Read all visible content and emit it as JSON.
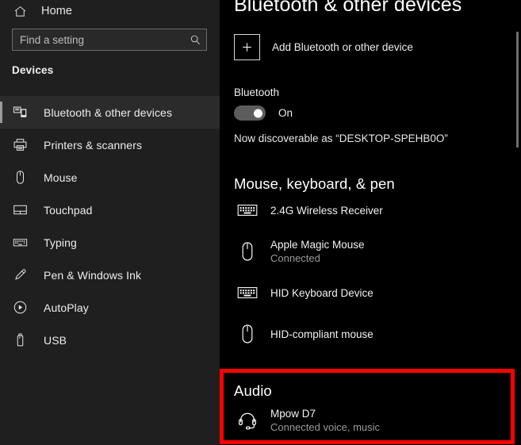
{
  "sidebar": {
    "home": {
      "label": "Home",
      "icon": "home-icon"
    },
    "search": {
      "placeholder": "Find a setting",
      "value": "",
      "icon": "search-icon"
    },
    "section_title": "Devices",
    "items": [
      {
        "label": "Bluetooth & other devices",
        "icon": "bluetooth-devices-icon",
        "selected": true
      },
      {
        "label": "Printers & scanners",
        "icon": "printer-icon",
        "selected": false
      },
      {
        "label": "Mouse",
        "icon": "mouse-icon",
        "selected": false
      },
      {
        "label": "Touchpad",
        "icon": "touchpad-icon",
        "selected": false
      },
      {
        "label": "Typing",
        "icon": "keyboard-icon",
        "selected": false
      },
      {
        "label": "Pen & Windows Ink",
        "icon": "pen-icon",
        "selected": false
      },
      {
        "label": "AutoPlay",
        "icon": "autoplay-icon",
        "selected": false
      },
      {
        "label": "USB",
        "icon": "usb-icon",
        "selected": false
      }
    ]
  },
  "main": {
    "title": "Bluetooth & other devices",
    "add_device": {
      "label": "Add Bluetooth or other device",
      "icon": "plus-icon"
    },
    "bluetooth": {
      "label": "Bluetooth",
      "state": "On",
      "toggle_on": true,
      "discoverable_text": "Now discoverable as “DESKTOP-SPEHB0O”"
    },
    "groups": [
      {
        "heading": "Mouse, keyboard, & pen",
        "devices": [
          {
            "name": "2.4G Wireless Receiver",
            "status": "",
            "icon": "keyboard-icon"
          },
          {
            "name": "Apple Magic Mouse",
            "status": "Connected",
            "icon": "mouse-icon"
          },
          {
            "name": "HID Keyboard Device",
            "status": "",
            "icon": "keyboard-icon"
          },
          {
            "name": "HID-compliant mouse",
            "status": "",
            "icon": "mouse-icon"
          }
        ]
      },
      {
        "heading": "Audio",
        "devices": [
          {
            "name": "Mpow D7",
            "status": "Connected voice, music",
            "icon": "headset-icon"
          }
        ]
      }
    ],
    "scrollbar": {
      "name": "vertical-scrollbar"
    }
  },
  "annotation": {
    "color": "#ff0000",
    "target": "audio-section"
  },
  "colors": {
    "sidebar_bg": "#1f1f1f",
    "main_bg": "#000000",
    "text_primary": "#f2f2f2",
    "text_secondary": "#9a9a9a",
    "toggle_track": "#5c5c5c",
    "annotation_red": "#ff0000"
  }
}
